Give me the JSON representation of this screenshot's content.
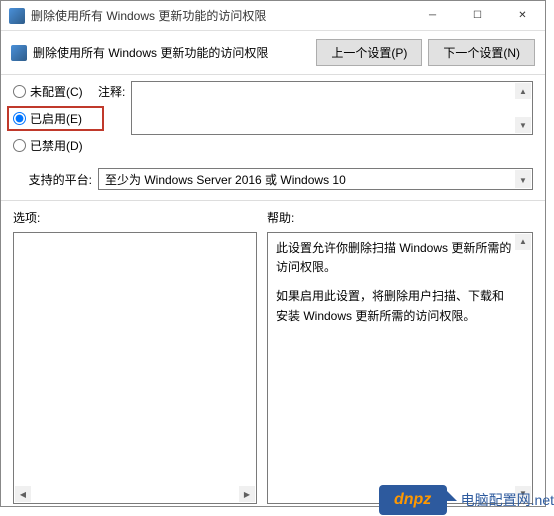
{
  "window": {
    "title": "删除使用所有 Windows 更新功能的访问权限"
  },
  "subheader": {
    "title": "删除使用所有 Windows 更新功能的访问权限",
    "prev_button": "上一个设置(P)",
    "next_button": "下一个设置(N)"
  },
  "radio": {
    "not_configured": "未配置(C)",
    "enabled": "已启用(E)",
    "disabled": "已禁用(D)",
    "selected": "enabled"
  },
  "comment": {
    "label": "注释:"
  },
  "platform": {
    "label": "支持的平台:",
    "value": "至少为 Windows Server 2016 或 Windows 10"
  },
  "options": {
    "label": "选项:"
  },
  "help": {
    "label": "帮助:",
    "text1": "此设置允许你删除扫描 Windows 更新所需的访问权限。",
    "text2": "如果启用此设置，将删除用户扫描、下载和安装 Windows 更新所需的访问权限。"
  },
  "watermark": {
    "logo": "dnpz",
    "domain": "电脑配置网",
    "suffix": ".net"
  }
}
